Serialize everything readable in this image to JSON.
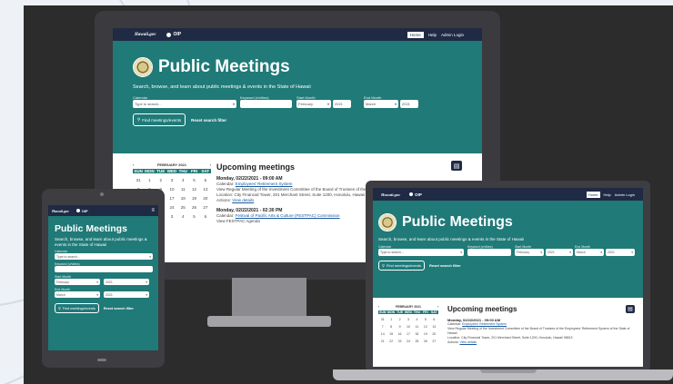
{
  "nav": {
    "logo": "Hawaii.gov",
    "oip": "OIP",
    "links": [
      "Home",
      "Help",
      "Admin Login"
    ]
  },
  "hero": {
    "title": "Public Meetings",
    "subtitle": "Search, browse, and learn about public meetings & events in the State of Hawaii",
    "labels": {
      "calendar": "Calendar",
      "keyword": "Keyword (v/vtlies)",
      "start_month": "Start Month",
      "end_month": "End Month"
    },
    "calendar_placeholder": "Type to search...",
    "start_month_value": "February",
    "start_year_value": "2021",
    "end_month_value": "March",
    "end_year_value": "2021",
    "find_button": "Find meetings/events",
    "reset_link": "Reset search filter"
  },
  "calendar": {
    "prev": "‹",
    "next": "›",
    "month": "FEBRUARY 2021",
    "days": [
      "SUN",
      "MON",
      "TUE",
      "WED",
      "THU",
      "FRI",
      "SAT"
    ],
    "dates": [
      "31",
      "1",
      "2",
      "3",
      "4",
      "5",
      "6",
      "7",
      "8",
      "9",
      "10",
      "11",
      "12",
      "13",
      "14",
      "15",
      "16",
      "17",
      "18",
      "19",
      "20",
      "21",
      "22",
      "23",
      "24",
      "25",
      "26",
      "27",
      "28",
      "1",
      "2",
      "3",
      "4",
      "5",
      "6"
    ]
  },
  "upcoming": {
    "title": "Upcoming meetings",
    "meetings": [
      {
        "date": "Monday, 02/22/2021 - 09:00 AM",
        "calendar_label": "Calendar:",
        "calendar_link": "Employees' Retirement System",
        "text": "View Regular Meeting of the Investment Committee of the Board of Trustees of the Employees' Retirement System of the State of Hawaii",
        "location": "Location: City Financial Tower, 201 Merchant Street, Suite 1200, Honolulu, Hawaii 96813",
        "actions": "Actions:",
        "details": "View details"
      },
      {
        "date": "Monday, 02/22/2021 - 02:30 PM",
        "calendar_label": "Calendar:",
        "calendar_link": "Festival of Pacific Arts & Culture (FESTPAC) Commission",
        "text": "View FESTPAC Agenda"
      }
    ]
  },
  "colors": {
    "teal": "#1f7a78",
    "navy": "#1f2a44"
  }
}
